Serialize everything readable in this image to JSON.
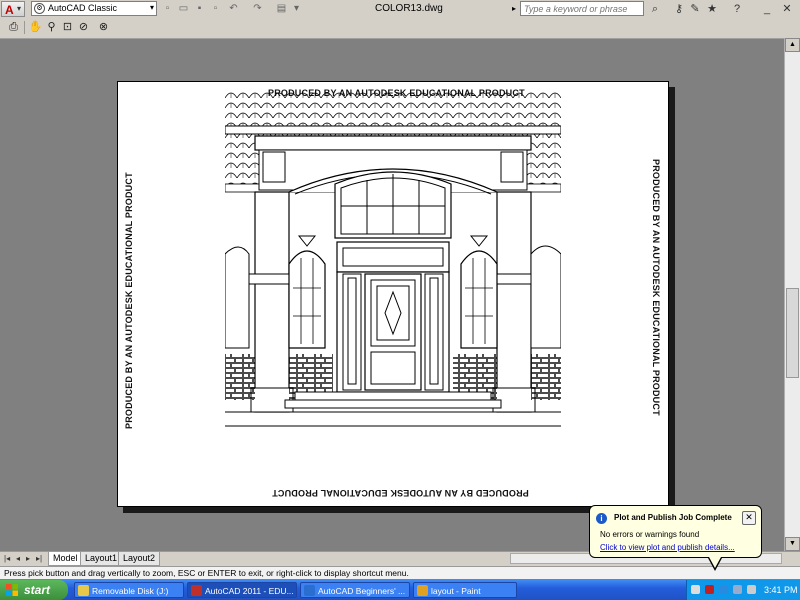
{
  "title_bar": {
    "workspace": "AutoCAD Classic",
    "document_title": "COLOR13.dwg",
    "search_placeholder": "Type a keyword or phrase",
    "icons": [
      "binoculars-icon",
      "key-icon",
      "wrench-icon",
      "star-icon",
      "help-icon",
      "minimize-icon",
      "close-icon"
    ]
  },
  "toolbar": {
    "icons": [
      "plot-icon",
      "pan-icon",
      "zoom-icon",
      "zoom-window-icon",
      "zoom-original-icon",
      "close-preview-icon"
    ]
  },
  "watermark_text": "PRODUCED BY AN AUTODESK EDUCATIONAL PRODUCT",
  "layout_tabs": [
    "Model",
    "Layout1",
    "Layout2"
  ],
  "active_tab": "Model",
  "command_line": "Press pick button and drag vertically to zoom, ESC or ENTER to exit, or right-click to display shortcut menu.",
  "notification": {
    "title": "Plot and Publish Job Complete",
    "message": "No errors or warnings found",
    "link": "Click to view plot and publish details..."
  },
  "taskbar": {
    "start_label": "start",
    "tasks": [
      {
        "label": "Removable Disk (J:)",
        "color": "#e8c84a"
      },
      {
        "label": "AutoCAD 2011 - EDU...",
        "color": "#c0302a"
      },
      {
        "label": "AutoCAD Beginners' ...",
        "color": "#2a6fd0"
      },
      {
        "label": "layout - Paint",
        "color": "#e0a020"
      }
    ],
    "clock": "3:41 PM"
  }
}
